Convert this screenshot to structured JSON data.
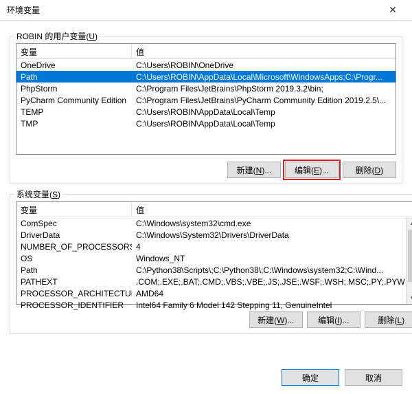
{
  "window": {
    "title": "环境变量"
  },
  "user_section": {
    "label_prefix": "ROBIN 的用户变量(",
    "label_hotkey": "U",
    "label_suffix": ")",
    "columns": {
      "var": "变量",
      "val": "值"
    },
    "rows": [
      {
        "var": "OneDrive",
        "val": "C:\\Users\\ROBIN\\OneDrive",
        "selected": false
      },
      {
        "var": "Path",
        "val": "C:\\Users\\ROBIN\\AppData\\Local\\Microsoft\\WindowsApps;C:\\Progr...",
        "selected": true
      },
      {
        "var": "PhpStorm",
        "val": "C:\\Program Files\\JetBrains\\PhpStorm 2019.3.2\\bin;",
        "selected": false
      },
      {
        "var": "PyCharm Community Edition",
        "val": "C:\\Program Files\\JetBrains\\PyCharm Community Edition 2019.2.5\\...",
        "selected": false
      },
      {
        "var": "TEMP",
        "val": "C:\\Users\\ROBIN\\AppData\\Local\\Temp",
        "selected": false
      },
      {
        "var": "TMP",
        "val": "C:\\Users\\ROBIN\\AppData\\Local\\Temp",
        "selected": false
      }
    ],
    "buttons": {
      "new": {
        "text": "新建(",
        "hotkey": "N",
        "suffix": ")..."
      },
      "edit": {
        "text": "编辑(",
        "hotkey": "E",
        "suffix": ")..."
      },
      "delete": {
        "text": "删除(",
        "hotkey": "D",
        "suffix": ")"
      }
    }
  },
  "sys_section": {
    "label_prefix": "系统变量(",
    "label_hotkey": "S",
    "label_suffix": ")",
    "columns": {
      "var": "变量",
      "val": "值"
    },
    "rows": [
      {
        "var": "ComSpec",
        "val": "C:\\Windows\\system32\\cmd.exe"
      },
      {
        "var": "DriverData",
        "val": "C:\\Windows\\System32\\Drivers\\DriverData"
      },
      {
        "var": "NUMBER_OF_PROCESSORS",
        "val": "4"
      },
      {
        "var": "OS",
        "val": "Windows_NT"
      },
      {
        "var": "Path",
        "val": "C:\\Python38\\Scripts\\;C:\\Python38\\;C:\\Windows\\system32;C:\\Wind..."
      },
      {
        "var": "PATHEXT",
        "val": ".COM;.EXE;.BAT;.CMD;.VBS;.VBE;.JS;.JSE;.WSF;.WSH;.MSC;.PY;.PYW"
      },
      {
        "var": "PROCESSOR_ARCHITECTURE",
        "val": "AMD64"
      },
      {
        "var": "PROCESSOR_IDENTIFIER",
        "val": "Intel64 Family 6 Model 142 Stepping 11, GenuineIntel"
      }
    ],
    "buttons": {
      "new": {
        "text": "新建(",
        "hotkey": "W",
        "suffix": ")..."
      },
      "edit": {
        "text": "编辑(",
        "hotkey": "I",
        "suffix": ")..."
      },
      "delete": {
        "text": "删除(",
        "hotkey": "L",
        "suffix": ")"
      }
    }
  },
  "footer": {
    "ok": "确定",
    "cancel": "取消"
  }
}
